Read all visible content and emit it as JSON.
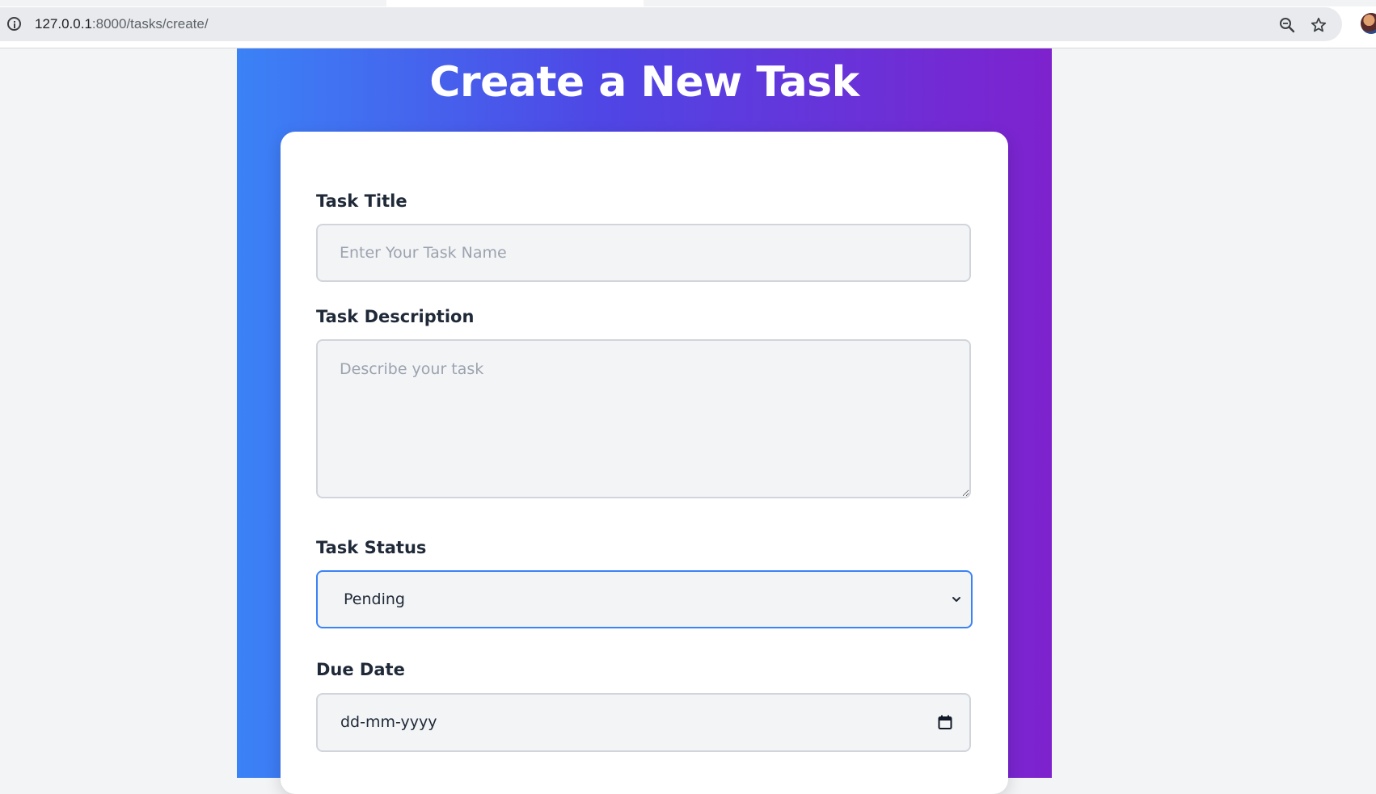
{
  "browser": {
    "url_host": "127.0.0.1",
    "url_path": ":8000/tasks/create/"
  },
  "page": {
    "title": "Create a New Task",
    "colors": {
      "gradient_start": "#3b82f6",
      "gradient_mid": "#4f46e5",
      "gradient_end": "#7e22ce",
      "focus_border": "#3b82f6"
    }
  },
  "form": {
    "title_label": "Task Title",
    "title_placeholder": "Enter Your Task Name",
    "title_value": "",
    "description_label": "Task Description",
    "description_placeholder": "Describe your task",
    "description_value": "",
    "status_label": "Task Status",
    "status_selected": "Pending",
    "due_date_label": "Due Date",
    "due_date_placeholder": "dd-mm-yyyy"
  },
  "icons": {
    "info": "info-icon",
    "zoom": "zoom-icon",
    "bookmark": "star-icon",
    "dropdown": "chevron-down-icon",
    "date_picker": "calendar-icon"
  }
}
